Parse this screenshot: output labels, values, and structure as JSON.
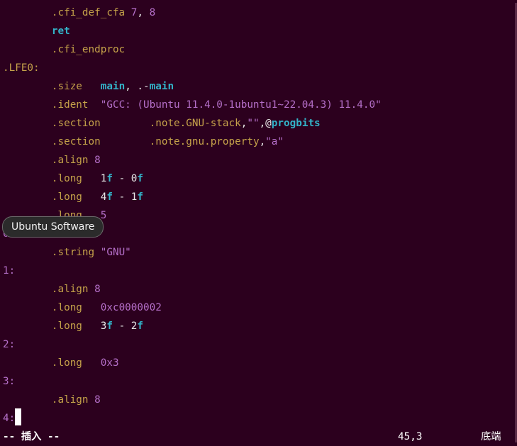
{
  "editor": {
    "lines": [
      [
        {
          "t": "        "
        },
        {
          "t": ".cfi_def_cfa",
          "c": "c-dir"
        },
        {
          "t": " "
        },
        {
          "t": "7",
          "c": "c-num"
        },
        {
          "t": ", ",
          "c": "c-plain"
        },
        {
          "t": "8",
          "c": "c-num"
        }
      ],
      [
        {
          "t": "        "
        },
        {
          "t": "ret",
          "c": "c-kw"
        }
      ],
      [
        {
          "t": "        "
        },
        {
          "t": ".cfi_endproc",
          "c": "c-dir"
        }
      ],
      [
        {
          "t": ".LFE0:",
          "c": "c-lbl"
        }
      ],
      [
        {
          "t": "        "
        },
        {
          "t": ".size",
          "c": "c-dir"
        },
        {
          "t": "   "
        },
        {
          "t": "main",
          "c": "c-kw"
        },
        {
          "t": ", .-",
          "c": "c-plain"
        },
        {
          "t": "main",
          "c": "c-kw"
        }
      ],
      [
        {
          "t": "        "
        },
        {
          "t": ".ident",
          "c": "c-dir"
        },
        {
          "t": "  "
        },
        {
          "t": "\"GCC: (Ubuntu 11.4.0-1ubuntu1~22.04.3) 11.4.0\"",
          "c": "c-str"
        }
      ],
      [
        {
          "t": "        "
        },
        {
          "t": ".section",
          "c": "c-dir"
        },
        {
          "t": "        "
        },
        {
          "t": ".note.GNU-stack",
          "c": "c-dir"
        },
        {
          "t": ",",
          "c": "c-plain"
        },
        {
          "t": "\"\"",
          "c": "c-str"
        },
        {
          "t": ",@",
          "c": "c-plain"
        },
        {
          "t": "progbits",
          "c": "c-kw"
        }
      ],
      [
        {
          "t": "        "
        },
        {
          "t": ".section",
          "c": "c-dir"
        },
        {
          "t": "        "
        },
        {
          "t": ".note.gnu.property",
          "c": "c-dir"
        },
        {
          "t": ",",
          "c": "c-plain"
        },
        {
          "t": "\"a\"",
          "c": "c-str"
        }
      ],
      [
        {
          "t": "        "
        },
        {
          "t": ".align",
          "c": "c-dir"
        },
        {
          "t": " "
        },
        {
          "t": "8",
          "c": "c-num"
        }
      ],
      [
        {
          "t": "        "
        },
        {
          "t": ".long",
          "c": "c-dir"
        },
        {
          "t": "   "
        },
        {
          "t": "1",
          "c": "c-plain"
        },
        {
          "t": "f",
          "c": "c-kw"
        },
        {
          "t": " - ",
          "c": "c-plain"
        },
        {
          "t": "0",
          "c": "c-plain"
        },
        {
          "t": "f",
          "c": "c-kw"
        }
      ],
      [
        {
          "t": "        "
        },
        {
          "t": ".long",
          "c": "c-dir"
        },
        {
          "t": "   "
        },
        {
          "t": "4",
          "c": "c-plain"
        },
        {
          "t": "f",
          "c": "c-kw"
        },
        {
          "t": " - ",
          "c": "c-plain"
        },
        {
          "t": "1",
          "c": "c-plain"
        },
        {
          "t": "f",
          "c": "c-kw"
        }
      ],
      [
        {
          "t": "        "
        },
        {
          "t": ".long",
          "c": "c-dir"
        },
        {
          "t": "   "
        },
        {
          "t": "5",
          "c": "c-num"
        }
      ],
      [
        {
          "t": "0:",
          "c": "c-nlbl"
        }
      ],
      [
        {
          "t": "        "
        },
        {
          "t": ".string",
          "c": "c-dir"
        },
        {
          "t": " "
        },
        {
          "t": "\"GNU\"",
          "c": "c-str"
        }
      ],
      [
        {
          "t": "1:",
          "c": "c-nlbl"
        }
      ],
      [
        {
          "t": "        "
        },
        {
          "t": ".align",
          "c": "c-dir"
        },
        {
          "t": " "
        },
        {
          "t": "8",
          "c": "c-num"
        }
      ],
      [
        {
          "t": "        "
        },
        {
          "t": ".long",
          "c": "c-dir"
        },
        {
          "t": "   "
        },
        {
          "t": "0xc0000002",
          "c": "c-num"
        }
      ],
      [
        {
          "t": "        "
        },
        {
          "t": ".long",
          "c": "c-dir"
        },
        {
          "t": "   "
        },
        {
          "t": "3",
          "c": "c-plain"
        },
        {
          "t": "f",
          "c": "c-kw"
        },
        {
          "t": " - ",
          "c": "c-plain"
        },
        {
          "t": "2",
          "c": "c-plain"
        },
        {
          "t": "f",
          "c": "c-kw"
        }
      ],
      [
        {
          "t": "2:",
          "c": "c-nlbl"
        }
      ],
      [
        {
          "t": "        "
        },
        {
          "t": ".long",
          "c": "c-dir"
        },
        {
          "t": "   "
        },
        {
          "t": "0x3",
          "c": "c-num"
        }
      ],
      [
        {
          "t": "3:",
          "c": "c-nlbl"
        }
      ],
      [
        {
          "t": "        "
        },
        {
          "t": ".align",
          "c": "c-dir"
        },
        {
          "t": " "
        },
        {
          "t": "8",
          "c": "c-num"
        }
      ],
      [
        {
          "t": "4:",
          "c": "c-nlbl"
        }
      ]
    ]
  },
  "tooltip": {
    "label": "Ubuntu Software"
  },
  "statusbar": {
    "mode": "-- 插入 --",
    "position": "45,3",
    "scroll": "底端"
  },
  "colors": {
    "background": "#2c001e",
    "directive": "#c6a24a",
    "number": "#b56fc9",
    "keyword": "#33b3c9"
  }
}
